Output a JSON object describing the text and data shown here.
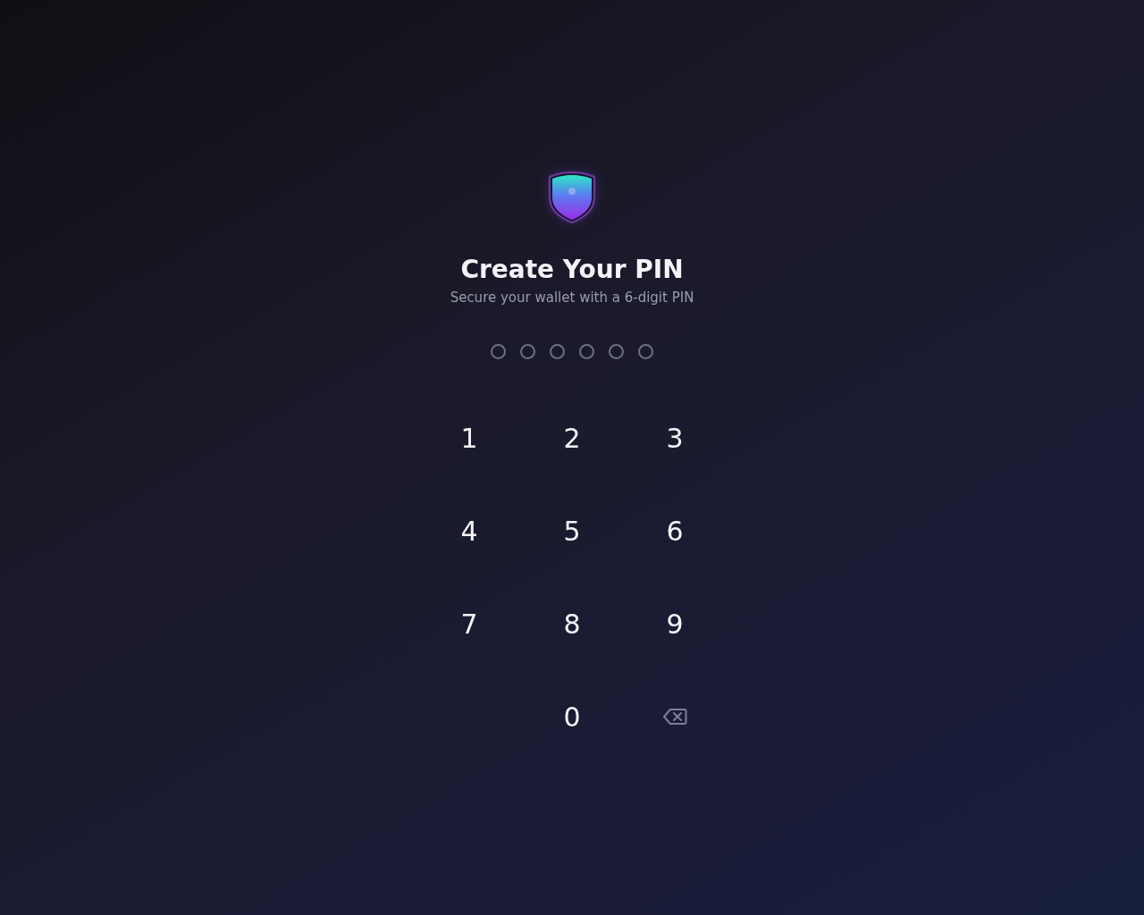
{
  "title": "Create Your PIN",
  "subtitle": "Secure your wallet with a 6-digit PIN",
  "pin_dots": [
    {
      "filled": false
    },
    {
      "filled": false
    },
    {
      "filled": false
    },
    {
      "filled": false
    },
    {
      "filled": false
    },
    {
      "filled": false
    }
  ],
  "keypad": [
    {
      "kind": "digit",
      "label": "1"
    },
    {
      "kind": "digit",
      "label": "2"
    },
    {
      "kind": "digit",
      "label": "3"
    },
    {
      "kind": "digit",
      "label": "4"
    },
    {
      "kind": "digit",
      "label": "5"
    },
    {
      "kind": "digit",
      "label": "6"
    },
    {
      "kind": "digit",
      "label": "7"
    },
    {
      "kind": "digit",
      "label": "8"
    },
    {
      "kind": "digit",
      "label": "9"
    },
    {
      "kind": "blank"
    },
    {
      "kind": "digit",
      "label": "0"
    },
    {
      "kind": "backspace"
    }
  ]
}
